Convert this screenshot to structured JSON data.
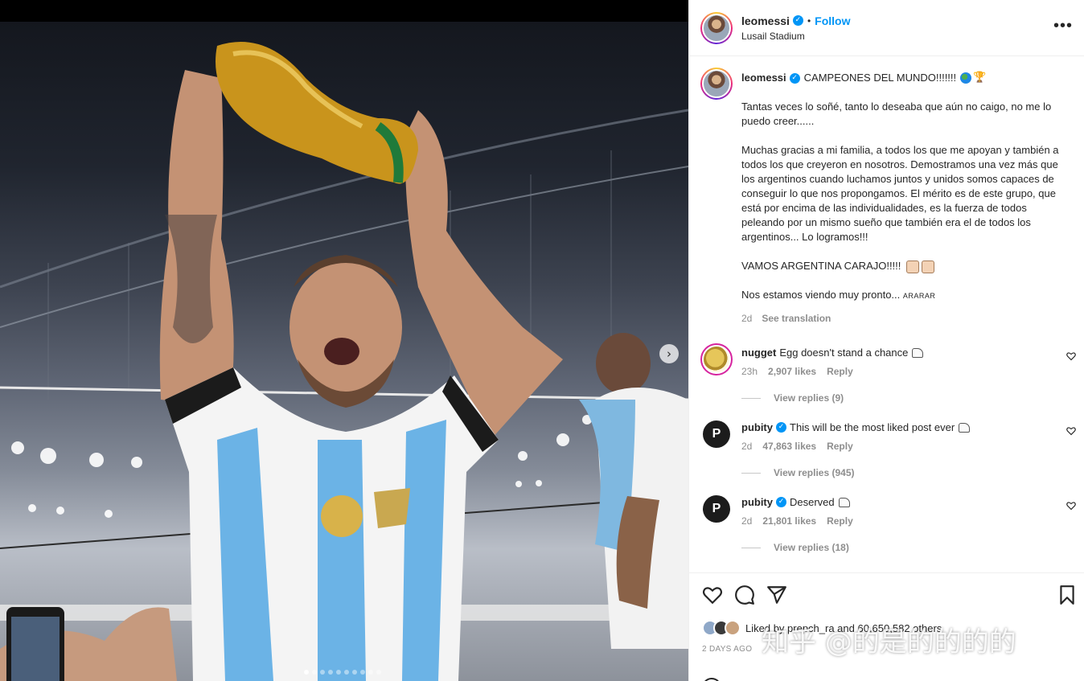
{
  "post": {
    "username": "leomessi",
    "follow_label": "Follow",
    "location": "Lusail Stadium",
    "separator": "•"
  },
  "media": {
    "carousel_dots": 10,
    "active_dot": 0,
    "next_arrow_icon": "chevron-right-icon"
  },
  "caption": {
    "username": "leomessi",
    "headline": "CAMPEONES DEL MUNDO!!!!!!!",
    "paragraphs": [
      "Tantas veces lo soñé, tanto lo deseaba que aún no caigo, no me lo puedo creer......",
      "Muchas gracias a mi familia, a todos los que me apoyan y también a todos los que creyeron en nosotros. Demostramos una vez más que los argentinos cuando luchamos juntos y unidos somos capaces de conseguir lo que nos propongamos. El mérito es de este grupo, que está por encima de las individualidades, es la fuerza de todos peleando por un mismo sueño que también era el de todos los argentinos... Lo logramos!!!",
      "VAMOS ARGENTINA CARAJO!!!!!"
    ],
    "last_line": "Nos estamos viendo muy pronto...",
    "last_tag": "ARARAR",
    "age": "2d",
    "see_translation": "See translation"
  },
  "comments": [
    {
      "username": "nugget",
      "verified": false,
      "text": "Egg doesn't stand a chance",
      "age": "23h",
      "likes": "2,907 likes",
      "reply": "Reply",
      "view_replies": "View replies (9)"
    },
    {
      "username": "pubity",
      "verified": true,
      "text": "This will be the most liked post ever",
      "age": "2d",
      "likes": "47,863 likes",
      "reply": "Reply",
      "view_replies": "View replies (945)"
    },
    {
      "username": "pubity",
      "verified": true,
      "text": "Deserved",
      "age": "2d",
      "likes": "21,801 likes",
      "reply": "Reply",
      "view_replies": "View replies (18)"
    }
  ],
  "footer": {
    "likes_text": "Liked by prepch_ra and 60,650,582 others",
    "date": "2 DAYS AGO",
    "watermark": "知乎 @的是的的的的"
  },
  "colors": {
    "accent": "#0095f6",
    "muted": "#8e8e8e",
    "text": "#262626"
  }
}
